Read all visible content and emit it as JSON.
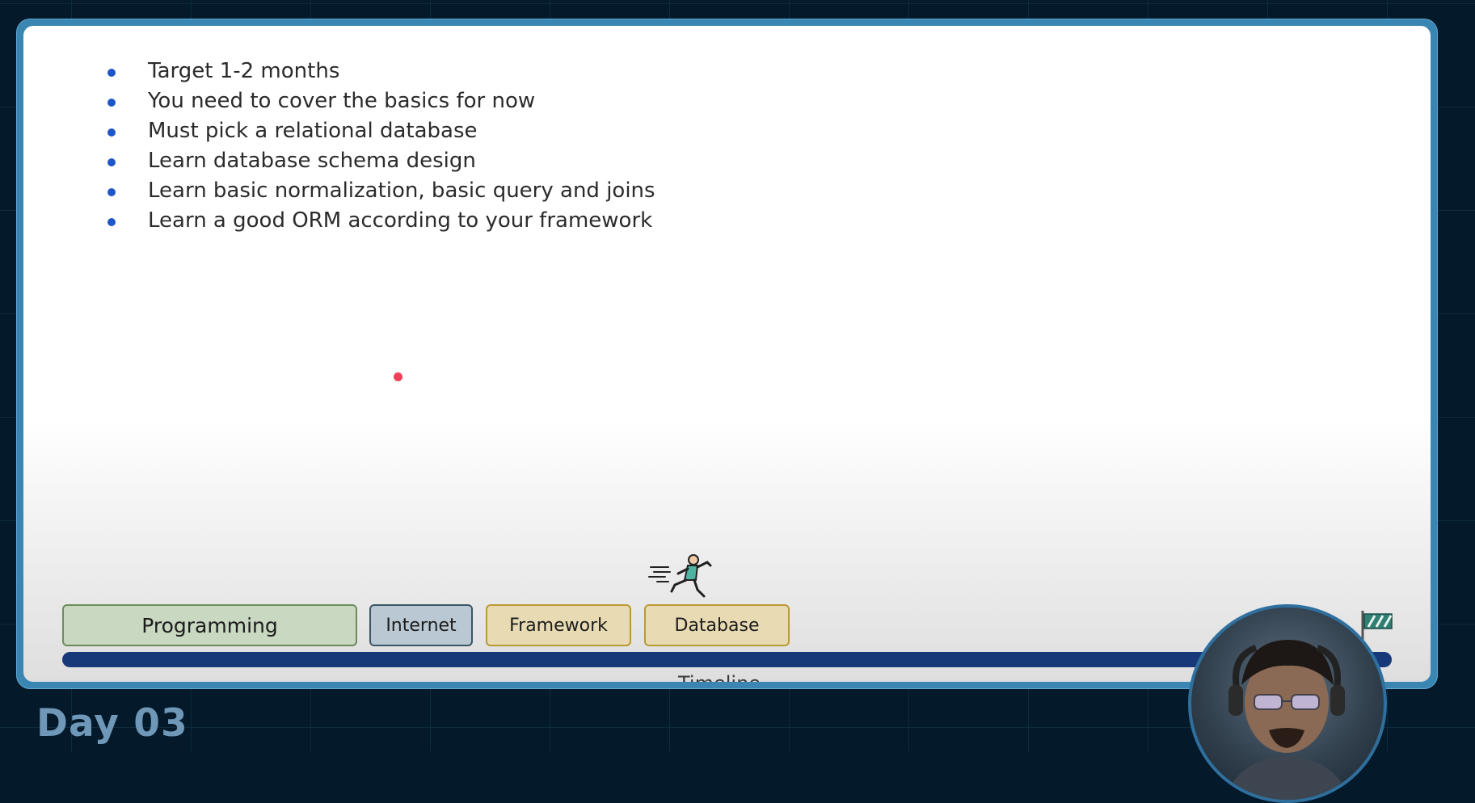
{
  "slide": {
    "bullets": [
      "Target 1-2 months",
      "You need to cover the basics for now",
      "Must pick a relational database",
      "Learn database schema design",
      "Learn basic normalization, basic query and joins",
      "Learn a good ORM according to your framework"
    ],
    "steps": [
      "Programming",
      "Internet",
      "Framework",
      "Database"
    ],
    "timeline_label": "Timeline"
  },
  "day_title": "Day 03",
  "icons": {
    "bullet": "bullet-dot-icon",
    "runner": "runner-icon",
    "flag": "finish-flag-icon",
    "pointer": "laser-pointer-icon"
  },
  "colors": {
    "background": "#04192a",
    "frame": "#3a86b3",
    "bullet": "#1f56c7",
    "timeline": "#17397a",
    "programming": "#c8d8c1",
    "internet": "#b9c8d2",
    "framework": "#e8dbb3",
    "database": "#e8dbb3",
    "pointer": "#ef4159",
    "day_title": "#6e97b8"
  }
}
